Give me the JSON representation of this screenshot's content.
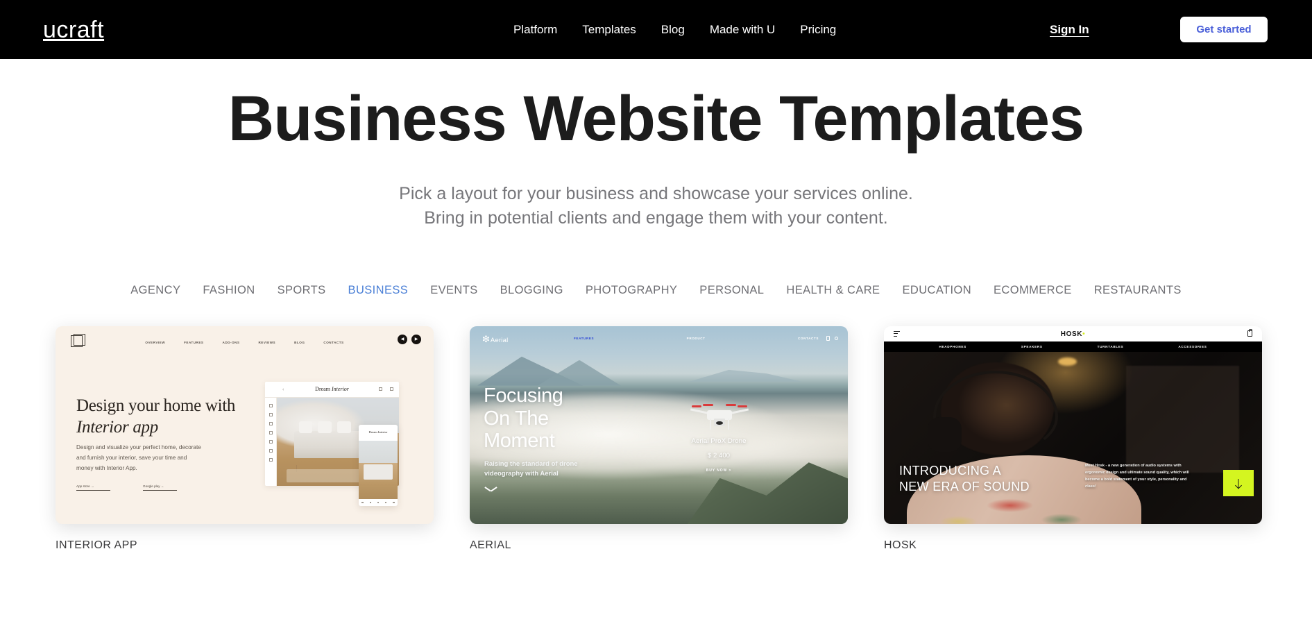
{
  "header": {
    "brand": "ucraft",
    "nav": [
      {
        "label": "Platform"
      },
      {
        "label": "Templates"
      },
      {
        "label": "Blog"
      },
      {
        "label": "Made with U"
      },
      {
        "label": "Pricing"
      }
    ],
    "sign_in": "Sign In",
    "get_started": "Get started",
    "background_color": "#000000",
    "get_started_text_color": "#4a5fd9"
  },
  "hero": {
    "title": "Business Website Templates",
    "subtitle_line1": "Pick a layout for your business and showcase your services online.",
    "subtitle_line2": "Bring in potential clients and engage them with your content."
  },
  "categories": {
    "active": "BUSINESS",
    "active_color": "#4a7fd6",
    "items": [
      {
        "label": "AGENCY"
      },
      {
        "label": "FASHION"
      },
      {
        "label": "SPORTS"
      },
      {
        "label": "BUSINESS"
      },
      {
        "label": "EVENTS"
      },
      {
        "label": "BLOGGING"
      },
      {
        "label": "PHOTOGRAPHY"
      },
      {
        "label": "PERSONAL"
      },
      {
        "label": "HEALTH & CARE"
      },
      {
        "label": "EDUCATION"
      },
      {
        "label": "ECOMMERCE"
      },
      {
        "label": "RESTAURANTS"
      }
    ]
  },
  "templates": [
    {
      "name": "INTERIOR APP",
      "preview": {
        "nav": [
          "OVERVIEW",
          "FEATURES",
          "ADD-ONS",
          "REVIEWS",
          "BLOG",
          "CONTACTS"
        ],
        "headline_line1": "Design your home with",
        "headline_line2": "Interior app",
        "body": "Design and visualize your perfect home, decorate and furnish your interior, save your time and money with Interior App.",
        "links": [
          "App store →",
          "Google play →"
        ],
        "browser_title_a": "Dream ",
        "browser_title_b": "Interior",
        "phone_title": "Dream Interior",
        "background_color": "#f9f1e8"
      }
    },
    {
      "name": "AERIAL",
      "preview": {
        "logo": "Aerial",
        "nav": [
          "FEATURES",
          "PRODUCT",
          "CONTACTS"
        ],
        "nav_active": "FEATURES",
        "headline_line1": "Focusing",
        "headline_line2": "On The",
        "headline_line3": "Moment",
        "subtitle": "Raising the standard of drone videography with Aerial",
        "product_name": "Aerial ProX Drone",
        "product_price": "$ 2 400",
        "product_cta": "BUY NOW >",
        "nav_active_color": "#2a44d8"
      }
    },
    {
      "name": "HOSK",
      "preview": {
        "logo": "HOSK",
        "logo_dot": "•",
        "nav": [
          "HEADPHONES",
          "SPEAKERS",
          "TURNTABLES",
          "ACCESSORIES"
        ],
        "headline_line1": "INTRODUCING A",
        "headline_line2": "NEW ERA OF SOUND",
        "copy": "Meet Hosk - a new generation of audio systems with ergonomic design and ultimate sound quality, which will become a bold statement of your style, personality and class!",
        "cta_color": "#d4f520"
      }
    }
  ]
}
